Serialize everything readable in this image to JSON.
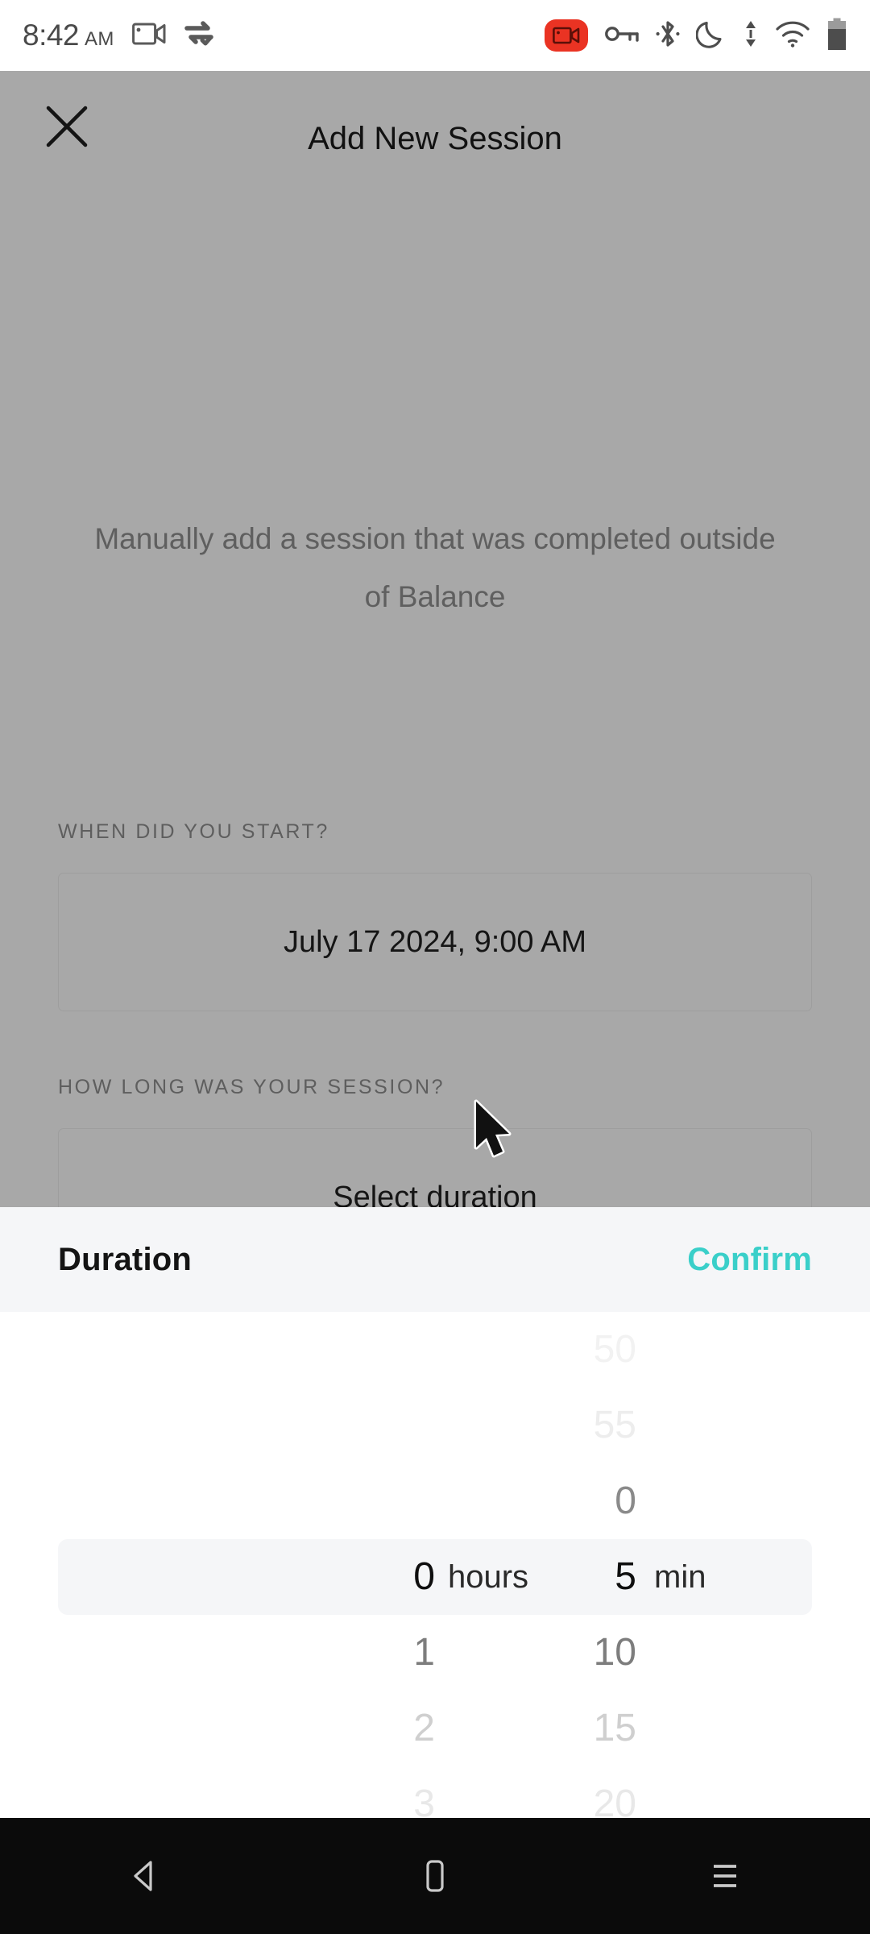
{
  "status_bar": {
    "time": "8:42",
    "meridiem": "AM",
    "left_icons": [
      "screen-record-icon",
      "data-sync-check-icon"
    ],
    "right_icons": [
      "screen-recording-active-badge",
      "vpn-key-icon",
      "bluetooth-icon",
      "do-not-disturb-moon-icon",
      "data-transfer-arrows-icon",
      "wifi-icon",
      "battery-icon"
    ]
  },
  "modal": {
    "close_label": "close-icon",
    "title": "Add New Session",
    "intro": "Manually add a session that was completed outside of Balance",
    "fields": [
      {
        "label": "WHEN DID YOU START?",
        "value": "July 17 2024, 9:00 AM"
      },
      {
        "label": "HOW LONG WAS YOUR SESSION?",
        "value": "Select duration"
      }
    ]
  },
  "sheet": {
    "title": "Duration",
    "confirm_label": "Confirm",
    "accent_color": "#3ACFC9",
    "hours_unit": "hours",
    "minutes_unit": "min",
    "hours": {
      "above": [],
      "selected": "0",
      "below": [
        "1",
        "2",
        "3"
      ]
    },
    "minutes": {
      "above": [
        "50",
        "55",
        "0"
      ],
      "selected": "5",
      "below": [
        "10",
        "15",
        "20"
      ]
    }
  },
  "navbar": {
    "back_label": "back-icon",
    "home_label": "home-icon",
    "recents_label": "recents-icon"
  }
}
